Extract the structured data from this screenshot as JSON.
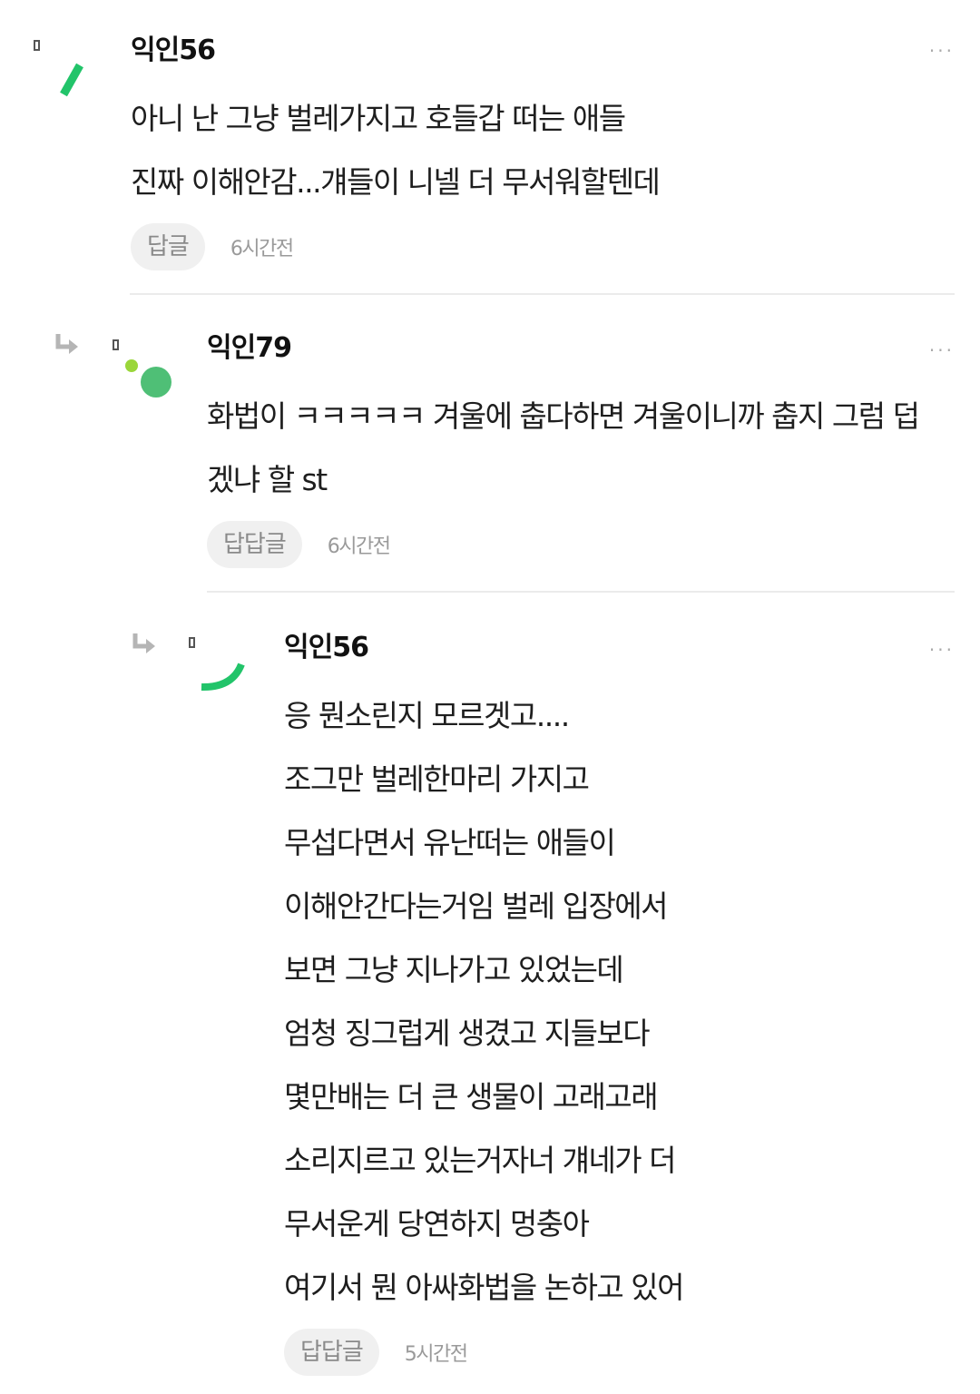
{
  "comments": [
    {
      "author": "익인56",
      "more": "···",
      "lines": [
        "아니 난 그냥 벌레가지고 호들갑 떠는 애들",
        "진짜 이해안감...걔들이 니넬 더 무서워할텐데"
      ],
      "reply_label": "답글",
      "time": "6시간전"
    },
    {
      "author": "익인79",
      "more": "···",
      "lines": [
        "화법이 ㅋㅋㅋㅋㅋ 겨울에 춥다하면 겨울이니까 춥지 그럼 덥",
        "겠냐 할 st"
      ],
      "reply_label": "답답글",
      "time": "6시간전"
    },
    {
      "author": "익인56",
      "more": "···",
      "lines": [
        "응 뭔소린지 모르겟고....",
        "조그만 벌레한마리 가지고",
        "무섭다면서 유난떠는 애들이",
        "이해안간다는거임 벌레 입장에서",
        "보면 그냥 지나가고 있었는데",
        "엄청 징그럽게 생겼고 지들보다",
        "몇만배는 더 큰 생물이 고래고래",
        "소리지르고 있는거자너 걔네가 더",
        "무서운게 당연하지 멍충아",
        "여기서 뭔 아싸화법을 논하고 있어"
      ],
      "reply_label": "답답글",
      "time": "5시간전"
    }
  ],
  "icons": {
    "reply_arrow": "reply-arrow-icon",
    "more": "more-dots-icon",
    "avatar": "avatar-icon"
  },
  "colors": {
    "accent_green": "#22c46a",
    "avatar_green": "#4fbf76",
    "avatar_lime": "#9ad63a"
  }
}
